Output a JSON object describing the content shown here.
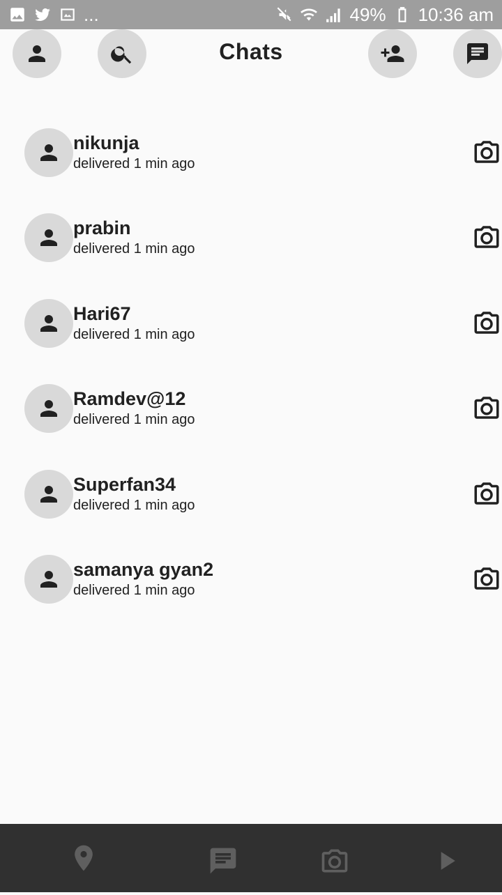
{
  "status_bar": {
    "left_extra": "...",
    "battery": "49%",
    "time": "10:36 am"
  },
  "header": {
    "title": "Chats",
    "icons": [
      "profile-icon",
      "search-icon",
      "add-friend-icon",
      "new-chat-icon"
    ]
  },
  "chats": [
    {
      "name": "nikunja",
      "status": "delivered 1 min ago"
    },
    {
      "name": "prabin",
      "status": "delivered 1 min ago"
    },
    {
      "name": "Hari67",
      "status": "delivered 1 min ago"
    },
    {
      "name": "Ramdev@12",
      "status": "delivered 1 min ago"
    },
    {
      "name": "Superfan34",
      "status": "delivered 1 min ago"
    },
    {
      "name": "samanya gyan2",
      "status": "delivered 1 min ago"
    }
  ],
  "bottom_nav": {
    "items": [
      "map-pin-icon",
      "chat-icon",
      "camera-icon",
      "play-icon"
    ]
  },
  "colors": {
    "status_bar": "#9e9e9e",
    "background": "#fafafa",
    "circle": "#d9d9d9",
    "bottom_nav": "#303030",
    "nav_icon": "#5f5f5f"
  }
}
